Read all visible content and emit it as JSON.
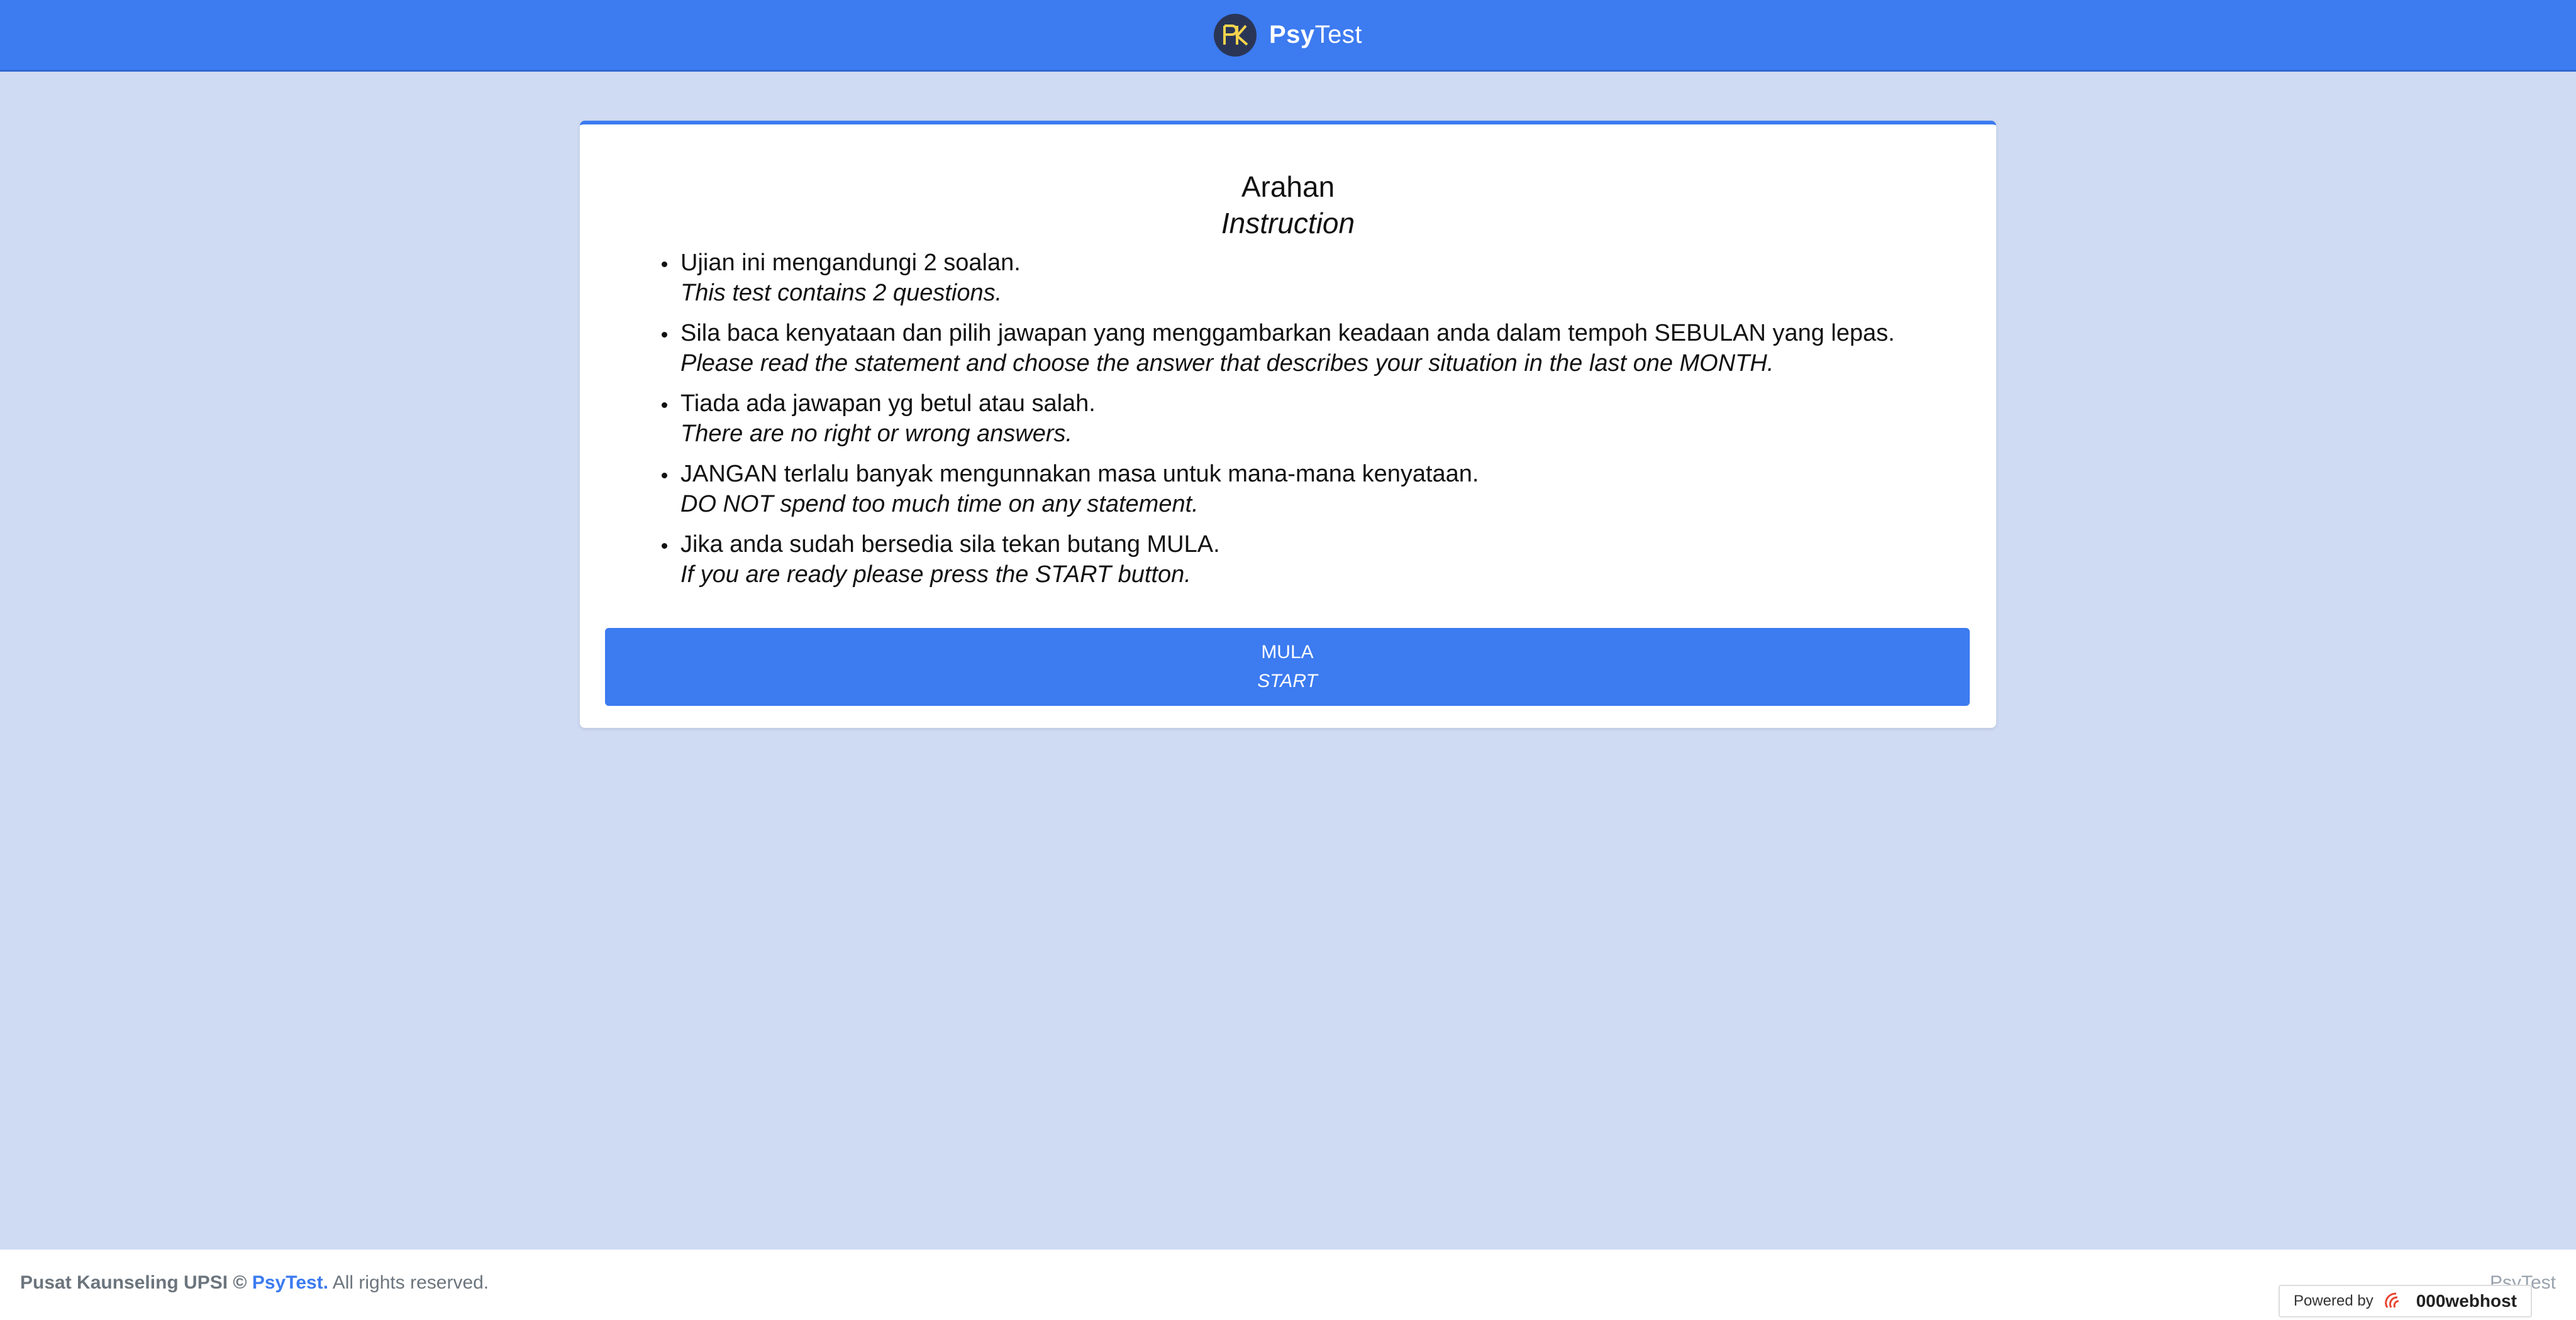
{
  "header": {
    "brand_bold": "Psy",
    "brand_light": "Test",
    "logo_icon": "pk-logo-icon",
    "color": "#3c7bf0"
  },
  "card": {
    "title": "Arahan",
    "subtitle": "Instruction",
    "items": [
      {
        "ms": "Ujian ini mengandungi 2 soalan.",
        "en": "This test contains 2 questions."
      },
      {
        "ms": "Sila baca kenyataan dan pilih jawapan yang menggambarkan keadaan anda dalam tempoh SEBULAN yang lepas.",
        "en": "Please read the statement and choose the answer that describes your situation in the last one MONTH."
      },
      {
        "ms": "Tiada ada jawapan yg betul atau salah.",
        "en": "There are no right or wrong answers."
      },
      {
        "ms": "JANGAN terlalu banyak mengunnakan masa untuk mana-mana kenyataan.",
        "en": "DO NOT spend too much time on any statement."
      },
      {
        "ms": "Jika anda sudah bersedia sila tekan butang MULA.",
        "en": "If you are ready please press the START button."
      }
    ],
    "start_label_ms": "MULA",
    "start_label_en": "START"
  },
  "footer": {
    "org": "Pusat Kaunseling UPSI ©",
    "brand": "PsyTest.",
    "rights": "All rights reserved.",
    "right_text": "PsyTest"
  },
  "powered": {
    "label": "Powered by",
    "host": "000webhost"
  }
}
